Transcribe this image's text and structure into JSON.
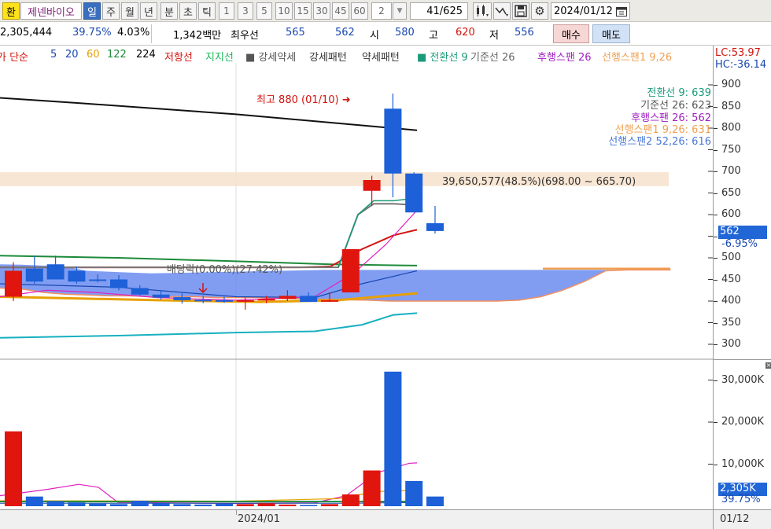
{
  "toolbar": {
    "tab_icon": "환",
    "stock_name": "제넨바이오",
    "periods": [
      "일",
      "주",
      "월",
      "년",
      "분",
      "초",
      "틱"
    ],
    "active_period": "일",
    "intervals": [
      "1",
      "3",
      "5",
      "10",
      "15",
      "30",
      "45",
      "60"
    ],
    "count_select": "2",
    "range_value": "41",
    "range_total": "/625",
    "date": "2024/01/12",
    "icons": [
      "chart-type-icon",
      "indicator-icon",
      "save-icon",
      "settings-icon",
      "calendar-icon"
    ]
  },
  "quote": {
    "volume": "2,305,444",
    "turnover_pct": "39.75%",
    "change_pct": "4.03%",
    "amount": "1,342백만",
    "best_label": "최우선",
    "best_ask": "565",
    "best_bid": "562",
    "open_label": "시",
    "open": "580",
    "high_label": "고",
    "high": "620",
    "low_label": "저",
    "low": "556",
    "buy_label": "매수",
    "sell_label": "매도"
  },
  "legend": [
    {
      "text": "가 단순",
      "color": "#d2140e"
    },
    {
      "text": "5",
      "color": "#1a48b0"
    },
    {
      "text": "20",
      "color": "#1a48b0"
    },
    {
      "text": "60",
      "color": "#e8a000"
    },
    {
      "text": "122",
      "color": "#1c8a3a"
    },
    {
      "text": "224",
      "color": "#000000"
    },
    {
      "text": "저항선",
      "color": "#d2140e"
    },
    {
      "text": "지지선",
      "color": "#1cb85a"
    },
    {
      "text": "■ 강세약세",
      "color": "#555555"
    },
    {
      "text": "강세패턴",
      "color": "#333333"
    },
    {
      "text": "약세패턴",
      "color": "#333333"
    },
    {
      "text": "■ 전환선 9",
      "color": "#1a9a7a"
    },
    {
      "text": "기준선 26",
      "color": "#666666"
    },
    {
      "text": "후행스팬 26",
      "color": "#a020c0"
    },
    {
      "text": "선행스팬1 9,26",
      "color": "#f0a050"
    }
  ],
  "right_axis": {
    "lc": "LC:53.97",
    "hc": "HC:-36.14",
    "price_ticks": [
      "900",
      "850",
      "800",
      "750",
      "700",
      "650",
      "600",
      "550",
      "500",
      "450",
      "400",
      "350",
      "300"
    ],
    "current_price": "562",
    "current_pct": "-6.95%",
    "volume_ticks": [
      "30,000K",
      "20,000K",
      "10,000K"
    ],
    "current_volume": "2,305K",
    "volume_pct": "39.75%"
  },
  "annotations": {
    "high_mark": "최고 880 (01/10)",
    "band_label": "39,650,577(48.5%)(698.00 ~ 665.70)",
    "dividend_label": "배당락(0.00%)(27.42%)"
  },
  "ichimoku_values": [
    {
      "text": "전환선 9: 639",
      "color": "#1a9a7a"
    },
    {
      "text": "기준선 26: 623",
      "color": "#555555"
    },
    {
      "text": "후행스팬 26: 562",
      "color": "#a020c0"
    },
    {
      "text": "선행스팬1 9,26: 631",
      "color": "#f0a050"
    },
    {
      "text": "선행스팬2 52,26: 616",
      "color": "#4a78d8"
    }
  ],
  "bottom_axis": {
    "month_label": "2024/01",
    "date_label": "01/12"
  },
  "chart_data": {
    "type": "candlestick",
    "y_range": [
      280,
      900
    ],
    "volume_range_k": [
      0,
      33000
    ],
    "candles": [
      {
        "o": 410,
        "h": 490,
        "l": 400,
        "c": 470,
        "dir": "up"
      },
      {
        "o": 475,
        "h": 505,
        "l": 440,
        "c": 445,
        "dir": "down"
      },
      {
        "o": 485,
        "h": 505,
        "l": 450,
        "c": 450,
        "dir": "down"
      },
      {
        "o": 470,
        "h": 480,
        "l": 440,
        "c": 445,
        "dir": "down"
      },
      {
        "o": 450,
        "h": 462,
        "l": 443,
        "c": 447,
        "dir": "down"
      },
      {
        "o": 450,
        "h": 460,
        "l": 425,
        "c": 430,
        "dir": "down"
      },
      {
        "o": 430,
        "h": 437,
        "l": 413,
        "c": 415,
        "dir": "down"
      },
      {
        "o": 415,
        "h": 425,
        "l": 403,
        "c": 408,
        "dir": "down"
      },
      {
        "o": 409,
        "h": 418,
        "l": 394,
        "c": 402,
        "dir": "down"
      },
      {
        "o": 403,
        "h": 412,
        "l": 395,
        "c": 402,
        "dir": "down"
      },
      {
        "o": 402,
        "h": 410,
        "l": 396,
        "c": 401,
        "dir": "down"
      },
      {
        "o": 400,
        "h": 408,
        "l": 380,
        "c": 402,
        "dir": "up"
      },
      {
        "o": 402,
        "h": 412,
        "l": 395,
        "c": 405,
        "dir": "up"
      },
      {
        "o": 405,
        "h": 425,
        "l": 400,
        "c": 412,
        "dir": "up"
      },
      {
        "o": 412,
        "h": 420,
        "l": 398,
        "c": 398,
        "dir": "down"
      },
      {
        "o": 402,
        "h": 420,
        "l": 398,
        "c": 402,
        "dir": "up"
      },
      {
        "o": 420,
        "h": 520,
        "l": 420,
        "c": 520,
        "dir": "up"
      },
      {
        "o": 655,
        "h": 690,
        "l": 620,
        "c": 680,
        "dir": "up"
      },
      {
        "o": 845,
        "h": 880,
        "l": 640,
        "c": 695,
        "dir": "down"
      },
      {
        "o": 695,
        "h": 698,
        "l": 605,
        "c": 605,
        "dir": "down"
      },
      {
        "o": 580,
        "h": 620,
        "l": 556,
        "c": 562,
        "dir": "down"
      }
    ],
    "volumes_k": [
      17800,
      2300,
      1200,
      900,
      600,
      500,
      1300,
      700,
      500,
      400,
      600,
      500,
      700,
      400,
      300,
      500,
      2800,
      8500,
      32000,
      6000,
      2305
    ]
  }
}
